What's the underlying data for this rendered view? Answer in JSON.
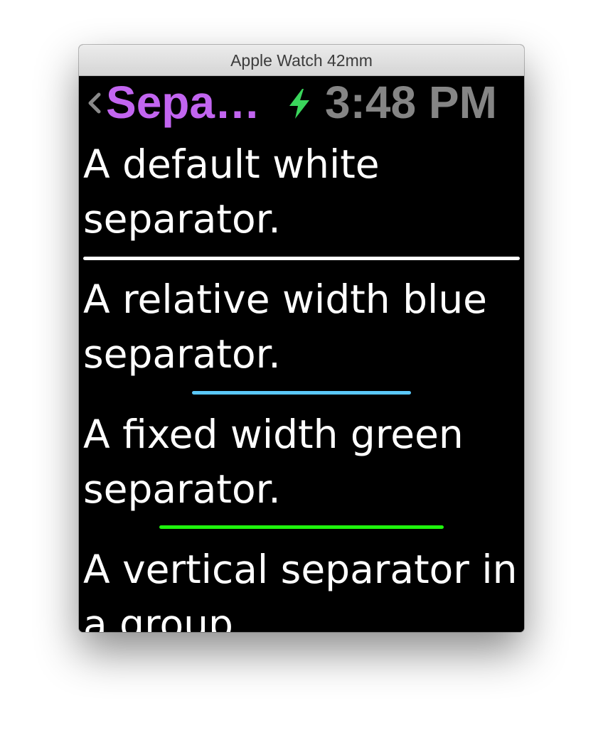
{
  "window": {
    "title": "Apple Watch 42mm"
  },
  "statusbar": {
    "back_icon": "chevron-left-icon",
    "title": "Sepa…",
    "title_color": "#c265f0",
    "charging_icon": "lightning-bolt-icon",
    "charging_color": "#3ad65c",
    "time": "3:48 PM",
    "time_color": "#858585"
  },
  "items": [
    {
      "label": "A default white separator.",
      "separator_color": "#ffffff",
      "separator_type": "full-width"
    },
    {
      "label": "A relative width blue separator.",
      "separator_color": "#5ac8fa",
      "separator_type": "relative-width"
    },
    {
      "label": "A fixed width green separator.",
      "separator_color": "#1ef40c",
      "separator_type": "fixed-width"
    },
    {
      "label": "A vertical separator in a group."
    }
  ],
  "colors": {
    "screen_background": "#000000",
    "text": "#ffffff"
  }
}
